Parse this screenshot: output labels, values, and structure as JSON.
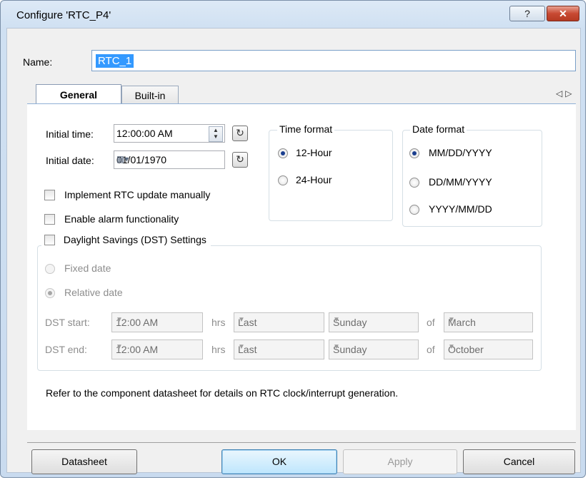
{
  "window": {
    "title": "Configure 'RTC_P4'",
    "help_label": "?",
    "close_label": "✕"
  },
  "name": {
    "label": "Name:",
    "value": "RTC_1"
  },
  "tabs": [
    {
      "label": "General"
    },
    {
      "label": "Built-in"
    }
  ],
  "tab_scroll": {
    "left": "◁",
    "right": "▷"
  },
  "general": {
    "initial_time": {
      "label": "Initial time:",
      "value": "12:00:00 AM"
    },
    "initial_date": {
      "label": "Initial date:",
      "value": "01/01/1970"
    },
    "checkboxes": [
      {
        "label": "Implement RTC update manually",
        "checked": false
      },
      {
        "label": "Enable alarm functionality",
        "checked": false
      },
      {
        "label": "Daylight Savings (DST) Settings",
        "checked": false
      }
    ],
    "time_format": {
      "title": "Time format",
      "options": [
        {
          "label": "12-Hour",
          "selected": true
        },
        {
          "label": "24-Hour",
          "selected": false
        }
      ]
    },
    "date_format": {
      "title": "Date format",
      "options": [
        {
          "label": "MM/DD/YYYY",
          "selected": true
        },
        {
          "label": "DD/MM/YYYY",
          "selected": false
        },
        {
          "label": "YYYY/MM/DD",
          "selected": false
        }
      ]
    },
    "dst": {
      "fixed_label": "Fixed date",
      "relative_label": "Relative date",
      "start": {
        "label": "DST start:",
        "time": "12:00 AM",
        "hrs": "hrs",
        "week": "Last",
        "day": "Sunday",
        "of": "of",
        "month": "March"
      },
      "end": {
        "label": "DST end:",
        "time": "12:00 AM",
        "hrs": "hrs",
        "week": "Last",
        "day": "Sunday",
        "of": "of",
        "month": "October"
      }
    },
    "note": "Refer to the component datasheet for details on RTC clock/interrupt generation."
  },
  "buttons": {
    "datasheet": "Datasheet",
    "ok": "OK",
    "apply": "Apply",
    "cancel": "Cancel"
  }
}
